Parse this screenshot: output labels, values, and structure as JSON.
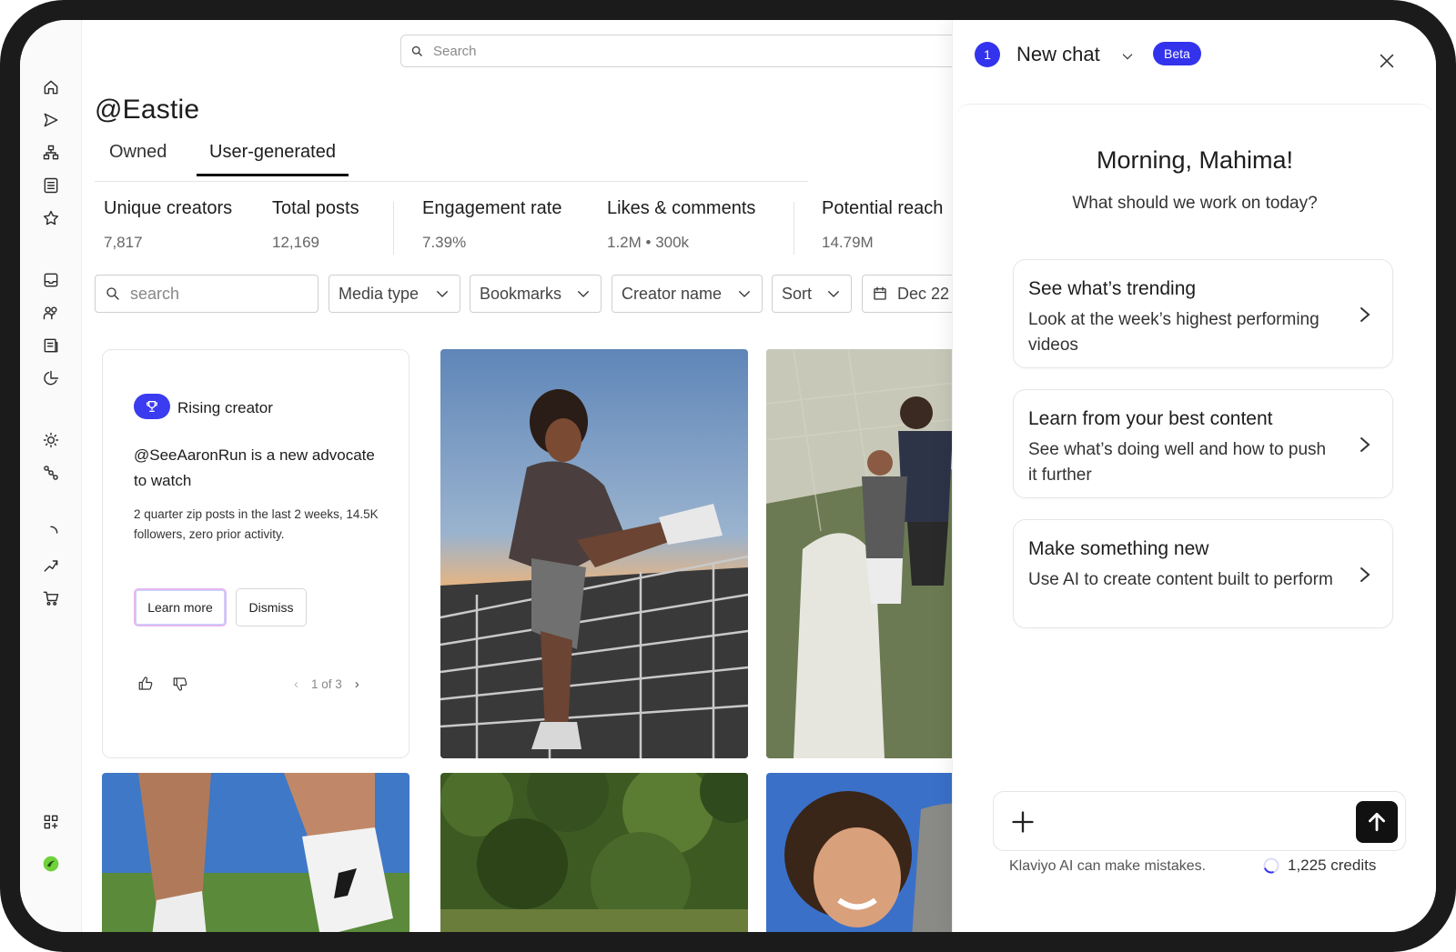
{
  "search": {
    "placeholder": "Search"
  },
  "page": {
    "handle": "@Eastie"
  },
  "tabs": [
    {
      "label": "Owned"
    },
    {
      "label": "User-generated"
    }
  ],
  "stats": [
    {
      "label": "Unique creators",
      "value": "7,817"
    },
    {
      "label": "Total posts",
      "value": "12,169"
    },
    {
      "label": "Engagement rate",
      "value": "7.39%"
    },
    {
      "label": "Likes & comments",
      "value": "1.2M • 300k"
    },
    {
      "label": "Potential reach",
      "value": "14.79M"
    }
  ],
  "filters": {
    "search_placeholder": "search",
    "media_type": "Media type",
    "bookmarks": "Bookmarks",
    "creator_name": "Creator name",
    "sort": "Sort",
    "date": "Dec 22"
  },
  "creator_card": {
    "badge": "Rising creator",
    "title": "@SeeAaronRun is a new advocate to watch",
    "body": "2 quarter zip posts in the last 2 weeks, 14.5K followers, zero prior activity.",
    "learn_more": "Learn more",
    "dismiss": "Dismiss",
    "pager": "1 of 3"
  },
  "chat": {
    "count": "1",
    "title": "New chat",
    "badge": "Beta",
    "greeting": "Morning, Mahima!",
    "subtitle": "What should we work on today?",
    "suggestions": [
      {
        "title": "See what’s trending",
        "desc": "Look at the week’s highest performing videos"
      },
      {
        "title": "Learn from your best content",
        "desc": "See what’s doing well and how to push it further"
      },
      {
        "title": "Make something new",
        "desc": "Use AI to create content built to perform"
      }
    ],
    "disclaimer": "Klaviyo AI can make mistakes.",
    "credits": "1,225 credits"
  },
  "colors": {
    "accent": "#3333ee",
    "frame": "#1b1b1b"
  },
  "icons": [
    "home-icon",
    "send-icon",
    "org-icon",
    "list-icon",
    "star-icon",
    "inbox-icon",
    "audience-icon",
    "content-icon",
    "analytics-icon",
    "bulb-icon",
    "flow-icon",
    "loading-icon",
    "trend-icon",
    "cart-icon",
    "apps-icon",
    "brand-icon"
  ]
}
